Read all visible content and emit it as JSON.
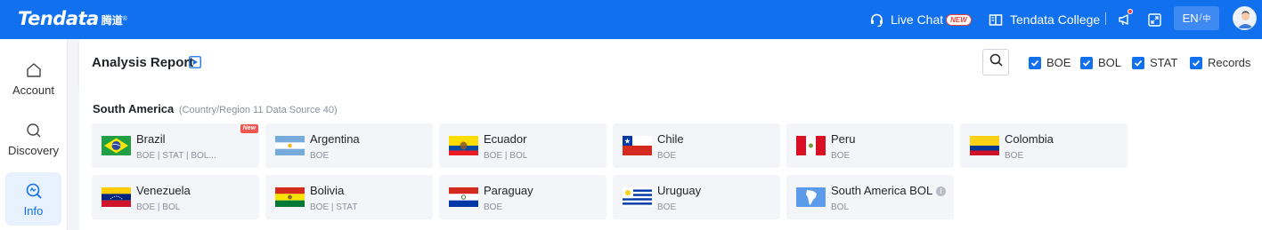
{
  "brand": {
    "name": "Tendata",
    "sub": "腾道",
    "reg": "®"
  },
  "topbar": {
    "live_chat": "Live Chat",
    "live_chat_badge": "NEW",
    "college": "Tendata College",
    "lang": {
      "en": "EN",
      "sep": "/",
      "zh": "中"
    }
  },
  "sidebar": {
    "items": [
      {
        "label": "Account",
        "icon": "home-icon"
      },
      {
        "label": "Discovery",
        "icon": "search-icon"
      },
      {
        "label": "Info",
        "icon": "info-search-icon",
        "active": true
      }
    ]
  },
  "header": {
    "title": "Analysis Report",
    "filters": [
      {
        "label": "BOE",
        "checked": true
      },
      {
        "label": "BOL",
        "checked": true
      },
      {
        "label": "STAT",
        "checked": true
      },
      {
        "label": "Records",
        "checked": true
      }
    ]
  },
  "section": {
    "title": "South America",
    "meta": "(Country/Region 11 Data Source 40)"
  },
  "countries": [
    {
      "name": "Brazil",
      "sources": "BOE | STAT | BOL...",
      "flag": "brazil",
      "badge": "New"
    },
    {
      "name": "Argentina",
      "sources": "BOE",
      "flag": "argentina"
    },
    {
      "name": "Ecuador",
      "sources": "BOE | BOL",
      "flag": "ecuador"
    },
    {
      "name": "Chile",
      "sources": "BOE",
      "flag": "chile"
    },
    {
      "name": "Peru",
      "sources": "BOE",
      "flag": "peru"
    },
    {
      "name": "Colombia",
      "sources": "BOE",
      "flag": "colombia"
    },
    {
      "name": "Venezuela",
      "sources": "BOE | BOL",
      "flag": "venezuela"
    },
    {
      "name": "Bolivia",
      "sources": "BOE | STAT",
      "flag": "bolivia"
    },
    {
      "name": "Paraguay",
      "sources": "BOE",
      "flag": "paraguay"
    },
    {
      "name": "Uruguay",
      "sources": "BOE",
      "flag": "uruguay"
    },
    {
      "name": "South America BOL",
      "sources": "BOL",
      "flag": "south-america-map"
    }
  ],
  "colors": {
    "brand": "#1170ee",
    "active_bg": "#e8f1fe",
    "new_badge": "#f0564d"
  }
}
